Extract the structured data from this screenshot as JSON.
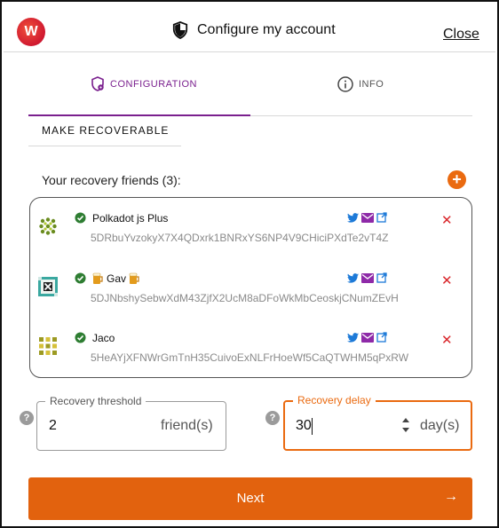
{
  "header": {
    "title": "Configure my account",
    "close_label": "Close",
    "logo_letter": "W"
  },
  "tabs": [
    {
      "label": "CONFIGURATION",
      "active": true,
      "icon": "shield-gear-icon"
    },
    {
      "label": "INFO",
      "active": false,
      "icon": "info-circle-icon"
    }
  ],
  "section": {
    "title": "MAKE RECOVERABLE",
    "friends_label": "Your recovery friends (3):",
    "add_icon": "plus-icon"
  },
  "friends": [
    {
      "name": "Polkadot js Plus",
      "name_prefix_icon": "",
      "name_suffix_icon": "",
      "address": "5DRbuYvzokyX7X4QDxrk1BNRxYS6NP4V9CHiciPXdTe2vT4Z",
      "verified": true
    },
    {
      "name": "Gav",
      "name_prefix_icon": "beer-icon",
      "name_suffix_icon": "beer-icon",
      "address": "5DJNbshySebwXdM43ZjfX2UcM8aDFoWkMbCeoskjCNumZEvH",
      "verified": true
    },
    {
      "name": "Jaco",
      "name_prefix_icon": "",
      "name_suffix_icon": "",
      "address": "5HeAYjXFNWrGmTnH35CuivoExNLFrHoeWf5CaQTWHM5qPxRW",
      "verified": true
    }
  ],
  "threshold": {
    "label": "Recovery threshold",
    "value": "2",
    "unit": "friend(s)"
  },
  "delay": {
    "label": "Recovery delay",
    "value": "30",
    "unit": "day(s)"
  },
  "next_button": {
    "label": "Next",
    "icon": "arrow-right-icon"
  },
  "colors": {
    "accent": "#e2620e",
    "purple": "#7a1f8e",
    "remove": "#d9262b",
    "verified": "#2e7d32",
    "social": "#1d7ad8"
  }
}
